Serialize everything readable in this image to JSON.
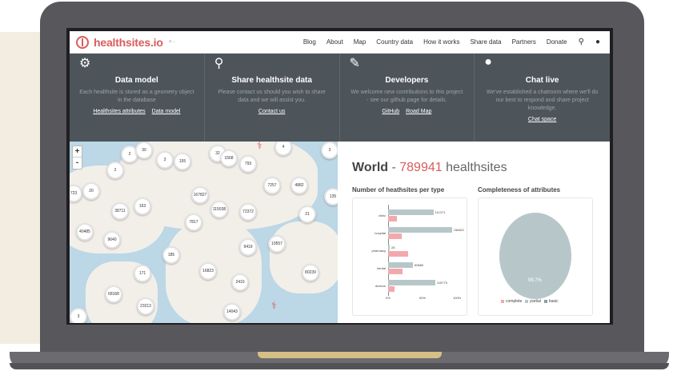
{
  "nav": {
    "brand": "healthsites.io",
    "items": [
      "Blog",
      "About",
      "Map",
      "Country data",
      "How it works",
      "Share data",
      "Partners",
      "Donate"
    ]
  },
  "features": [
    {
      "title": "Data model",
      "icon": "gear-icon",
      "desc": "Each healthsite is stored as a geometry object in the database",
      "links": [
        "Healthsites attributes",
        "Data model"
      ]
    },
    {
      "title": "Share healthsite data",
      "icon": "map-marker-icon",
      "desc": "Please contact us should you wish to share data and we will assist you.",
      "links": [
        "Contact us"
      ]
    },
    {
      "title": "Developers",
      "icon": "pencil-icon",
      "desc": "We welcome new contributions to this project - see our github page for details.",
      "links": [
        "GitHub",
        "Road Map"
      ]
    },
    {
      "title": "Chat live",
      "icon": "chat-icon",
      "desc": "We've established a chatroom where we'll do our best to respond and share project knowledge.",
      "links": [
        "Chat space"
      ]
    }
  ],
  "map": {
    "zoom_in": "+",
    "zoom_out": "-",
    "clusters": [
      "2",
      "30",
      "3",
      "155",
      "32",
      "1568",
      "793",
      "4",
      "3",
      "2",
      "723",
      "20",
      "167827",
      "7257",
      "4882",
      "135",
      "38711",
      "163",
      "115038",
      "72372",
      "21",
      "7817",
      "40485",
      "9640",
      "9419",
      "19557",
      "185",
      "171",
      "16823",
      "2410",
      "80239",
      "68168",
      "23213",
      "3",
      "14043"
    ]
  },
  "stats": {
    "world": "World",
    "dash": " - ",
    "count": "789941",
    "suffix": " healthsites",
    "chart1_title": "Number of heathsites per type",
    "chart2_title": "Completeness of attributes",
    "pie_label": "99.7%",
    "legend": [
      "complete",
      "partial",
      "basic"
    ]
  },
  "chart_data": [
    {
      "type": "bar",
      "title": "Number of heathsites per type",
      "categories": [
        "clinic",
        "hospital",
        "pharmacy",
        "dental",
        "doctors"
      ],
      "series": [
        {
          "values": [
            111371,
            156821,
            28,
            60880,
            115779
          ]
        },
        {
          "values": [
            0.13,
            0.2,
            0.3,
            0.22,
            0.1
          ]
        }
      ],
      "data_labels": [
        "111371",
        "156821",
        "28",
        "60880",
        "115779"
      ],
      "x_ticks": [
        "0%",
        "50%",
        "100%"
      ],
      "xlim": [
        0,
        1
      ]
    },
    {
      "type": "pie",
      "title": "Completeness of attributes",
      "labels": [
        "complete",
        "partial",
        "basic"
      ],
      "values": [
        0.1,
        99.7,
        0.2
      ],
      "colors": [
        "#f2a9ad",
        "#b7c7c9",
        "#8f9ca3"
      ]
    }
  ],
  "colors": {
    "brand": "#d95c5c",
    "feature_bg": "#4d555b",
    "map_water": "#bcd7e6",
    "bar_gray": "#b7c7c9",
    "bar_pink": "#f2a9ad"
  }
}
